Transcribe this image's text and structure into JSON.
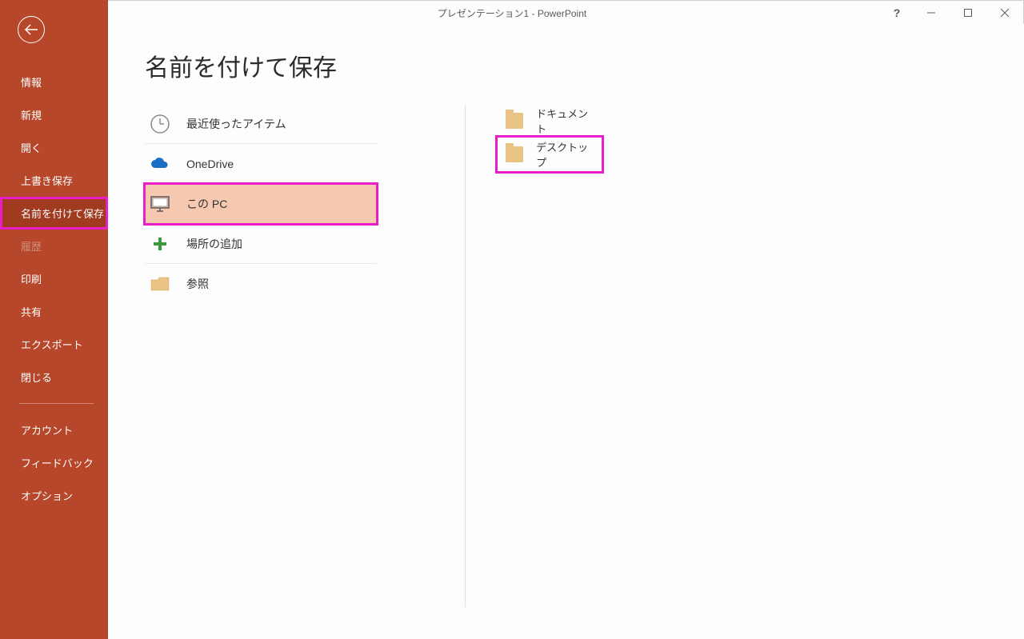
{
  "window": {
    "title": "プレゼンテーション1  -  PowerPoint"
  },
  "sidebar": {
    "items": [
      {
        "label": "情報"
      },
      {
        "label": "新規"
      },
      {
        "label": "開く"
      },
      {
        "label": "上書き保存"
      },
      {
        "label": "名前を付けて保存",
        "selected": true
      },
      {
        "label": "履歴",
        "disabled": true
      },
      {
        "label": "印刷"
      },
      {
        "label": "共有"
      },
      {
        "label": "エクスポート"
      },
      {
        "label": "閉じる"
      }
    ],
    "bottom_items": [
      {
        "label": "アカウント"
      },
      {
        "label": "フィードバック"
      },
      {
        "label": "オプション"
      }
    ]
  },
  "page": {
    "title": "名前を付けて保存"
  },
  "locations": [
    {
      "label": "最近使ったアイテム",
      "icon": "clock"
    },
    {
      "label": "OneDrive",
      "icon": "cloud"
    },
    {
      "label": "この PC",
      "icon": "pc",
      "selected": true
    },
    {
      "label": "場所の追加",
      "icon": "plus"
    },
    {
      "label": "参照",
      "icon": "folder"
    }
  ],
  "folders": [
    {
      "label": "ドキュメント"
    },
    {
      "label": "デスクトップ",
      "highlighted": true
    }
  ]
}
